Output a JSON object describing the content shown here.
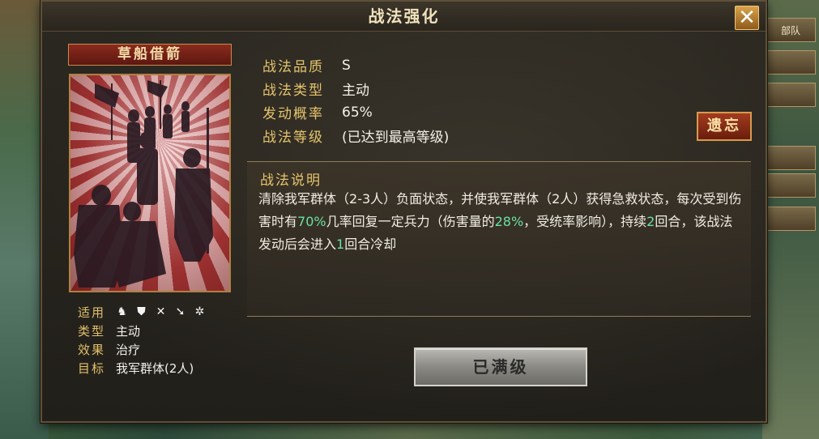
{
  "dialog": {
    "title": "战法强化",
    "close_label": "✕"
  },
  "card": {
    "name": "草船借箭",
    "applicable_label": "适用",
    "applicable_icons": [
      "cavalry-icon",
      "shield-icon",
      "bow-icon",
      "spear-icon",
      "wheel-icon"
    ],
    "type_label": "类型",
    "type_value": "主动",
    "effect_label": "效果",
    "effect_value": "治疗",
    "target_label": "目标",
    "target_value": "我军群体(2人)"
  },
  "info": {
    "quality_label": "战法品质",
    "quality_value": "S",
    "type_label": "战法类型",
    "type_value": "主动",
    "chance_label": "发动概率",
    "chance_value": "65%",
    "level_label": "战法等级",
    "level_value": "(已达到最高等级)"
  },
  "forget_button": "遗忘",
  "description": {
    "title": "战法说明",
    "part1": "清除我军群体（2-3人）负面状态，并使我军群体（2人）获得急救状态，每次受到伤害时有",
    "pct1": "70%",
    "part2": "几率回复一定兵力（伤害量的",
    "pct2": "28%",
    "part3": "，受统率影响），持续",
    "turns": "2",
    "part4": "回合，该战法发动后会进入",
    "cooldown": "1",
    "part5": "回合冷却"
  },
  "max_button": "已满级",
  "background": {
    "tags": [
      "部队",
      "",
      "",
      "",
      "",
      ""
    ]
  }
}
